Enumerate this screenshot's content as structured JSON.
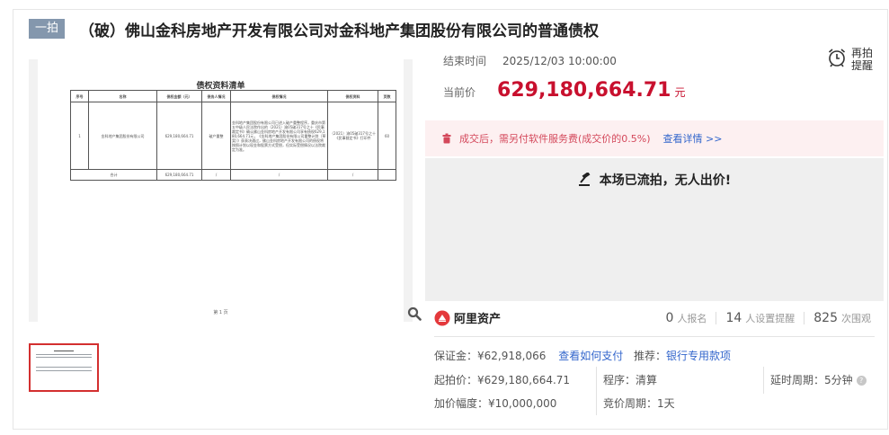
{
  "header": {
    "round_badge": "一拍",
    "title": "（破）佛山金科房地产开发有限公司对金科地产集团股份有限公司的普通债权"
  },
  "document": {
    "title": "债权资料清单",
    "headers": [
      "序号",
      "名称",
      "债权金额（元）",
      "债务人情况",
      "债权情况",
      "债权资料",
      "页数"
    ],
    "row": {
      "no": "1",
      "name": "金科地产集团股份有限公司",
      "amount": "629,180,664.71",
      "debtor_status": "破产重整",
      "claim_desc": "金科地产集团股份有限公司已进入破产重整程序，重庆市第五中级人民法院作出的（2021）渝05破317号之十《民事裁定书》确认佛山金科房地产开发有限公司享有债权629,180,664.71元，《金科地产集团股份有限公司重整计划（草案）》获表决通过，佛山金科房地产开发有限公司的债权将按照计划以现金和股票方式受偿，但实际受偿情况以法院裁定为准。",
      "claim_docs": "（2021）渝05破317号之十《民事裁定书》打印件",
      "pages": "60"
    },
    "total_label": "合计",
    "total_amount": "629,180,664.71",
    "total_dash": "/",
    "footer": "第 1 页"
  },
  "auction": {
    "end_label": "结束时间",
    "end_time": "2025/12/03 10:00:00",
    "remind_label_1": "再拍",
    "remind_label_2": "提醒",
    "price_label": "当前价",
    "price_value": "629,180,664.71",
    "price_unit": "元",
    "fee_text": "成交后，需另付软件服务费(成交价的0.5%)",
    "fee_link": "查看详情 >>",
    "status_text": "本场已流拍，无人出价!",
    "platform": "阿里资产",
    "stats": [
      {
        "num": "0",
        "label": "人报名"
      },
      {
        "num": "14",
        "label": "人设置提醒"
      },
      {
        "num": "825",
        "label": "次围观"
      }
    ],
    "deposit_label": "保证金：",
    "deposit_value": "¥62,918,066",
    "deposit_link": "查看如何支付",
    "recommend_label": "推荐：",
    "recommend_link": "银行专用款项",
    "start_price": "起拍价：¥629,180,664.71",
    "increment": "加价幅度：¥10,000,000",
    "procedure": "程序：清算",
    "bid_cycle": "竞价周期：1天",
    "delay_cycle": "延时周期：5分钟",
    "help_icon": "?"
  },
  "colors": {
    "accent_red": "#c8102e",
    "link_blue": "#3366cc",
    "badge_bg": "#8497ad"
  }
}
